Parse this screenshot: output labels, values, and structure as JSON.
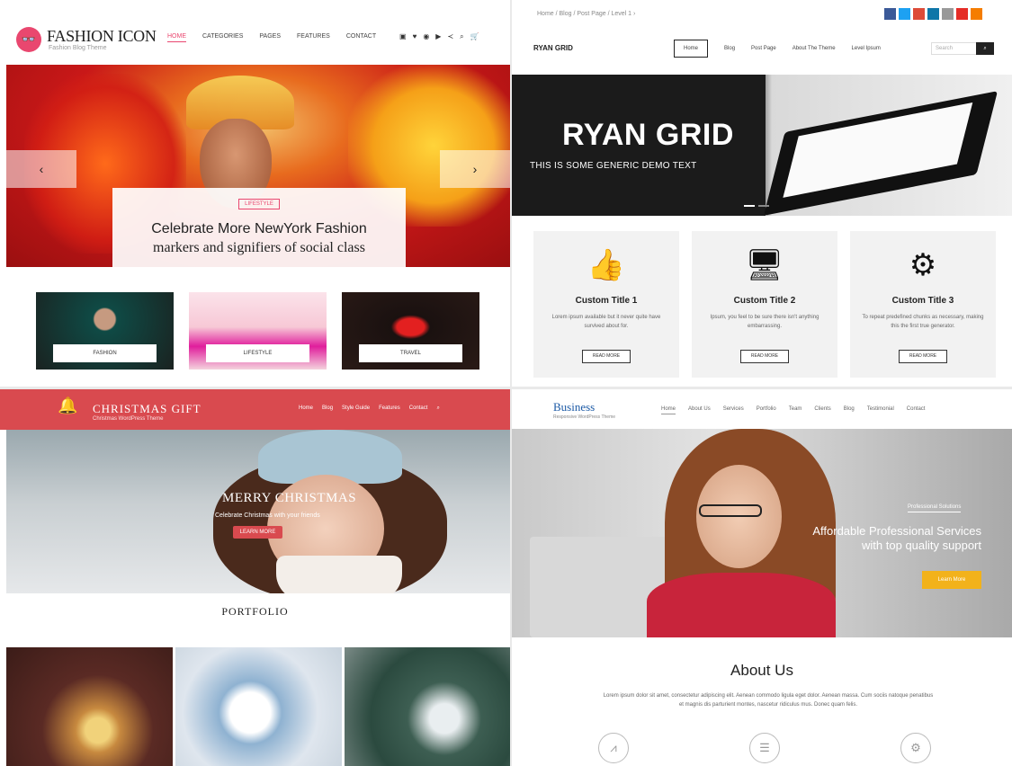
{
  "fashion": {
    "brand": "FASHION ICON",
    "tagline": "Fashion Blog Theme",
    "logo_glyph": "👓",
    "nav": [
      "Home",
      "Categories",
      "Pages",
      "Features",
      "Contact"
    ],
    "social": [
      "f",
      "t",
      "p",
      "v",
      "s",
      "q",
      "cart"
    ],
    "hero_badge": "Lifestyle",
    "hero_title": "Celebrate More NewYork Fashion",
    "hero_subtitle": "markers and signifiers of social class",
    "arrow_prev": "‹",
    "arrow_next": "›",
    "cards": [
      {
        "label": "Fashion",
        "color1": "#0f4a45",
        "color2": "#1a2220"
      },
      {
        "label": "Lifestyle",
        "color1": "#f7c8d6",
        "color2": "#e01e9c"
      },
      {
        "label": "Travel",
        "color1": "#1a1110",
        "color2": "#c91b1b"
      }
    ],
    "accent": "#e9476f"
  },
  "ryan": {
    "breadcrumb": "Home / Blog / Post Page / Level 1 ›",
    "social_colors": [
      "#3b5998",
      "#1da1f2",
      "#dd4b39",
      "#0e76a8",
      "#999999",
      "#e52d27",
      "#f57d00"
    ],
    "logo": "RYAN GRID",
    "nav": [
      "Home",
      "Blog",
      "Post Page",
      "About The Theme",
      "Level Ipsum"
    ],
    "search_placeholder": "Search",
    "search_btn": "⌕",
    "hero_title": "RYAN GRID",
    "hero_subtitle": "THIS IS SOME GENERIC DEMO TEXT",
    "features": [
      {
        "icon": "👍",
        "icon_name": "thumbs-up-icon",
        "title": "Custom Title 1",
        "text": "Lorem ipsum available but it never quite have survived about for.",
        "button": "Read More"
      },
      {
        "icon": "🖥",
        "icon_name": "monitor-icon",
        "title": "Custom Title 2",
        "text": "Ipsum, you feel to be sure there isn't anything embarrassing.",
        "button": "Read More"
      },
      {
        "icon": "⚙",
        "icon_name": "gears-icon",
        "title": "Custom Title 3",
        "text": "To repeat predefined chunks as necessary, making this the first true generator.",
        "button": "Read More"
      }
    ]
  },
  "christmas": {
    "brand": "CHRISTMAS GIFT",
    "tagline": "Christmas WordPress Theme",
    "logo_glyph": "🔔",
    "nav": [
      "Home",
      "Blog",
      "Style Guide",
      "Features",
      "Contact",
      "⌕"
    ],
    "hero_title": "MERRY CHRISTMAS",
    "hero_subtitle": "Celebrate Christmas with your friends",
    "hero_button": "Learn More",
    "section_title": "PORTFOLIO",
    "tiles": [
      {
        "color1": "#5a2a24",
        "color2": "#e0b25c"
      },
      {
        "color1": "#dfe6ee",
        "color2": "#6b8fb0"
      },
      {
        "color1": "#7a8a86",
        "color2": "#2b4a3f"
      }
    ]
  },
  "business": {
    "logo": "Business",
    "tagline": "Responsive WordPress Theme",
    "nav": [
      "Home",
      "About Us",
      "Services",
      "Portfolio",
      "Team",
      "Clients",
      "Blog",
      "Testimonial",
      "Contact"
    ],
    "hero_label": "Professional Solutions",
    "hero_line1": "Affordable Professional Services",
    "hero_line2": "with top quality support",
    "hero_button": "Learn More",
    "accent": "#f2b21b",
    "about_title": "About Us",
    "about_text": "Lorem ipsum dolor sit amet, consectetur adipiscing elit. Aenean commodo ligula eget dolor. Aenean massa. Cum sociis natoque penatibus et magnis dis parturient montes, nascetur ridiculus mus. Donec quam felis.",
    "icons": [
      "chart-icon",
      "list-icon",
      "gear-icon"
    ]
  }
}
